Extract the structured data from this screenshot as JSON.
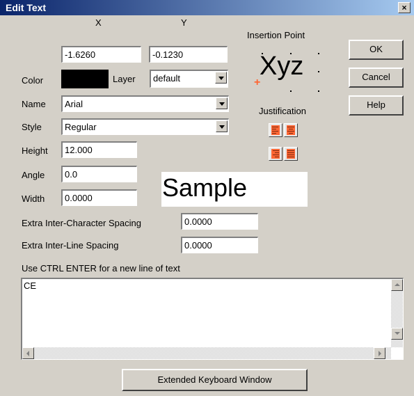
{
  "window": {
    "title": "Edit Text",
    "close_label": "×"
  },
  "position": {
    "x_label": "X",
    "y_label": "Y",
    "x_value": "-1.6260",
    "y_value": "-0.1230"
  },
  "color": {
    "label": "Color",
    "swatch": "#000000"
  },
  "layer": {
    "label": "Layer",
    "value": "default"
  },
  "name": {
    "label": "Name",
    "value": "Arial"
  },
  "style": {
    "label": "Style",
    "value": "Regular"
  },
  "height": {
    "label": "Height",
    "value": "12.000"
  },
  "angle": {
    "label": "Angle",
    "value": "0.0"
  },
  "width": {
    "label": "Width",
    "value": "0.0000"
  },
  "insertion": {
    "label": "Insertion Point",
    "preview_text": "Xyz"
  },
  "justification": {
    "label": "Justification",
    "options": [
      "left",
      "center",
      "right",
      "full"
    ]
  },
  "sample": {
    "text": "Sample"
  },
  "spacing": {
    "char_label": "Extra Inter-Character Spacing",
    "char_value": "0.0000",
    "line_label": "Extra Inter-Line Spacing",
    "line_value": "0.0000"
  },
  "text_area": {
    "hint": "Use CTRL ENTER for a new line of text",
    "value": "CE"
  },
  "buttons": {
    "ok": "OK",
    "cancel": "Cancel",
    "help": "Help",
    "keyboard": "Extended Keyboard Window"
  },
  "colors": {
    "accent": "#ff6633",
    "titlebar": "#0a246a"
  }
}
